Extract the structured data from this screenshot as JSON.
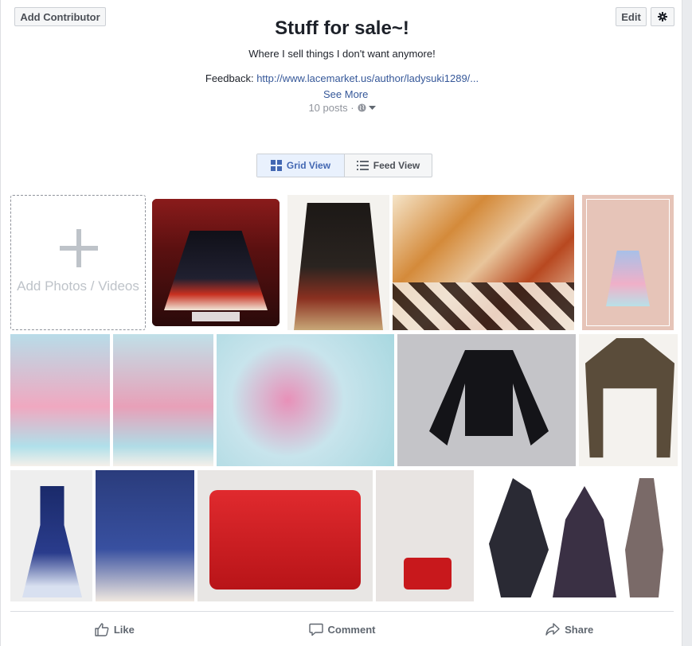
{
  "header": {
    "add_contributor": "Add Contributor",
    "edit": "Edit",
    "settings_icon": "gear-icon"
  },
  "album": {
    "title": "Stuff for sale~!",
    "description": "Where I sell things I don't want anymore!",
    "feedback_label": "Feedback: ",
    "feedback_link": "http://www.lacemarket.us/author/ladysuki1289/...",
    "see_more": "See More",
    "posts": "10 posts ·",
    "privacy_icon": "globe-icon"
  },
  "view_toggle": {
    "grid": "Grid View",
    "feed": "Feed View",
    "active": "grid"
  },
  "add_tile": {
    "label": "Add Photos / Videos"
  },
  "actions": {
    "like": "Like",
    "comment": "Comment",
    "share": "Share"
  },
  "colors": {
    "link": "#365899",
    "accent": "#4267b2"
  }
}
